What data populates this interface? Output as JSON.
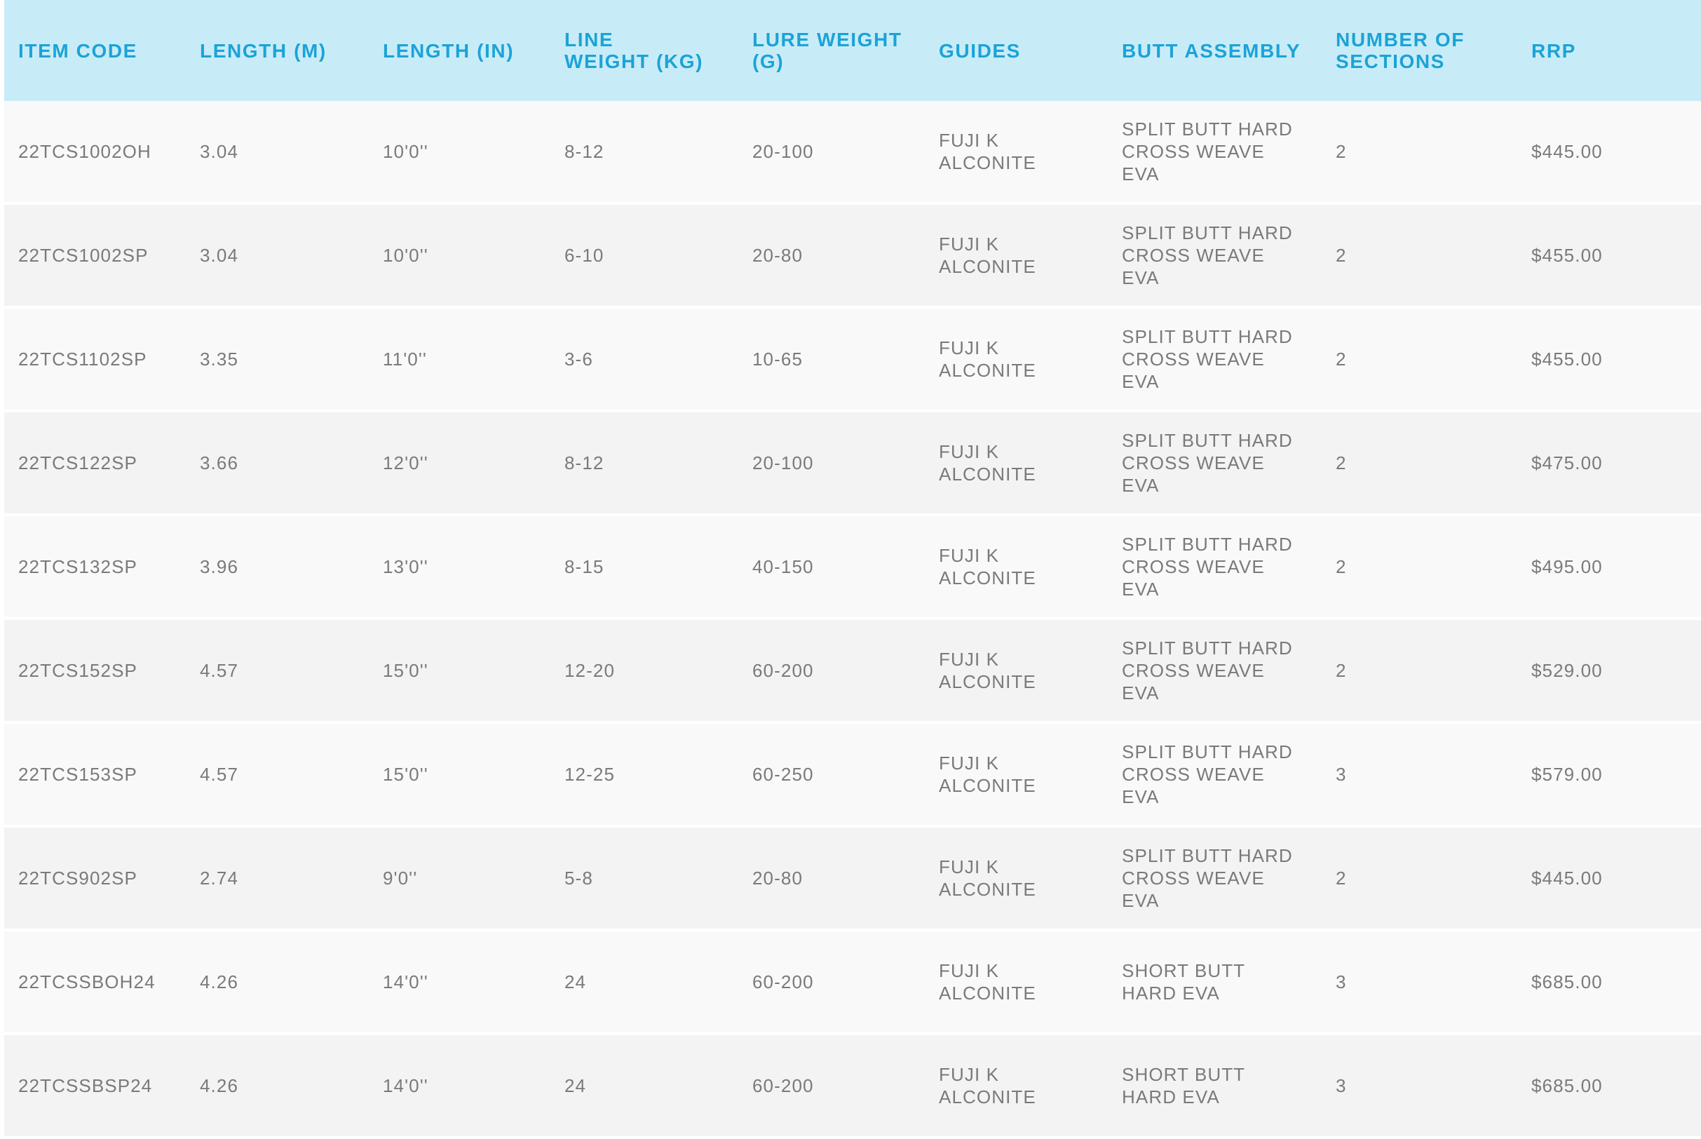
{
  "table": {
    "headers": [
      "ITEM CODE",
      "LENGTH (M)",
      "LENGTH (IN)",
      "LINE WEIGHT (KG)",
      "LURE WEIGHT (G)",
      "GUIDES",
      "BUTT ASSEMBLY",
      "NUMBER OF SECTIONS",
      "RRP"
    ],
    "rows": [
      [
        "22TCS1002OH",
        "3.04",
        "10'0''",
        "8-12",
        "20-100",
        "FUJI K ALCONITE",
        "SPLIT BUTT HARD CROSS WEAVE EVA",
        "2",
        "$445.00"
      ],
      [
        "22TCS1002SP",
        "3.04",
        "10'0''",
        "6-10",
        "20-80",
        "FUJI K ALCONITE",
        "SPLIT BUTT HARD CROSS WEAVE EVA",
        "2",
        "$455.00"
      ],
      [
        "22TCS1102SP",
        "3.35",
        "11'0''",
        "3-6",
        "10-65",
        "FUJI K ALCONITE",
        "SPLIT BUTT HARD CROSS WEAVE EVA",
        "2",
        "$455.00"
      ],
      [
        "22TCS122SP",
        "3.66",
        "12'0''",
        "8-12",
        "20-100",
        "FUJI K ALCONITE",
        "SPLIT BUTT HARD CROSS WEAVE EVA",
        "2",
        "$475.00"
      ],
      [
        "22TCS132SP",
        "3.96",
        "13'0''",
        "8-15",
        "40-150",
        "FUJI K ALCONITE",
        "SPLIT BUTT HARD CROSS WEAVE EVA",
        "2",
        "$495.00"
      ],
      [
        "22TCS152SP",
        "4.57",
        "15'0''",
        "12-20",
        "60-200",
        "FUJI K ALCONITE",
        "SPLIT BUTT HARD CROSS WEAVE EVA",
        "2",
        "$529.00"
      ],
      [
        "22TCS153SP",
        "4.57",
        "15'0''",
        "12-25",
        "60-250",
        "FUJI K ALCONITE",
        "SPLIT BUTT HARD CROSS WEAVE EVA",
        "3",
        "$579.00"
      ],
      [
        "22TCS902SP",
        "2.74",
        "9'0''",
        "5-8",
        "20-80",
        "FUJI K ALCONITE",
        "SPLIT BUTT HARD CROSS WEAVE EVA",
        "2",
        "$445.00"
      ],
      [
        "22TCSSBOH24",
        "4.26",
        "14'0''",
        "24",
        "60-200",
        "FUJI K ALCONITE",
        "SHORT BUTT HARD EVA",
        "3",
        "$685.00"
      ],
      [
        "22TCSSBSP24",
        "4.26",
        "14'0''",
        "24",
        "60-200",
        "FUJI K ALCONITE",
        "SHORT BUTT HARD EVA",
        "3",
        "$685.00"
      ]
    ]
  },
  "colors": {
    "header_background": "#c8ecf7",
    "header_text": "#1ba3d8",
    "body_text": "#7a7a7a",
    "row_odd": "#f9f9f9",
    "row_even": "#f3f3f3"
  }
}
